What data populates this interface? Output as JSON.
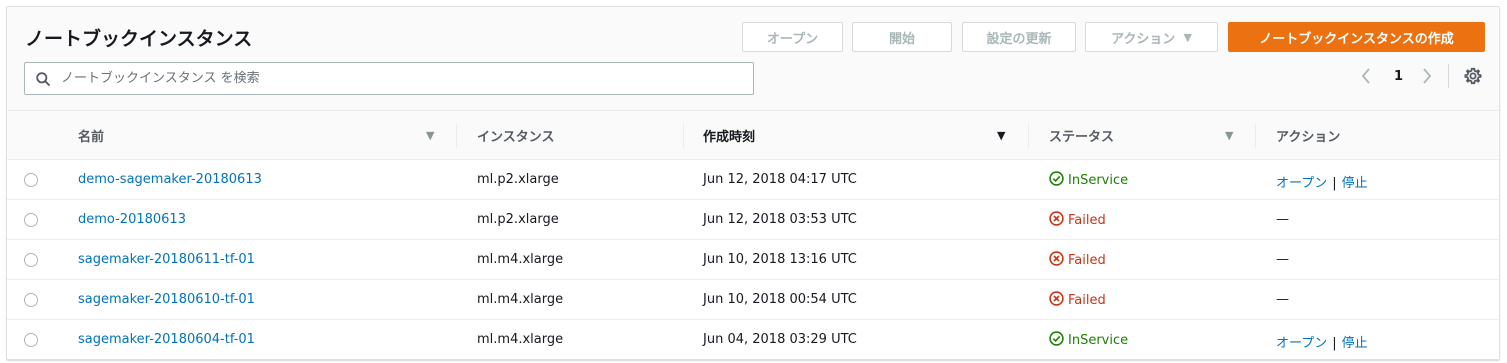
{
  "header": {
    "title": "ノートブックインスタンス",
    "buttons": {
      "open": "オープン",
      "start": "開始",
      "update": "設定の更新",
      "actions": "アクション",
      "create": "ノートブックインスタンスの作成"
    },
    "search_placeholder": "ノートブックインスタンス を検索",
    "page_number": "1"
  },
  "colors": {
    "primary": "#ec7211",
    "link": "#0073bb",
    "success": "#1d8102",
    "error": "#d13212"
  },
  "table": {
    "columns": [
      "名前",
      "インスタンス",
      "作成時刻",
      "ステータス",
      "アクション"
    ],
    "rows": [
      {
        "name": "demo-sagemaker-20180613",
        "instance": "ml.p2.xlarge",
        "created": "Jun 12, 2018 04:17 UTC",
        "status": "InService",
        "status_kind": "ok",
        "action_open": "オープン",
        "action_sep": "|",
        "action_stop": "停止",
        "action_none": ""
      },
      {
        "name": "demo-20180613",
        "instance": "ml.p2.xlarge",
        "created": "Jun 12, 2018 03:53 UTC",
        "status": "Failed",
        "status_kind": "fail",
        "action_open": "",
        "action_sep": "",
        "action_stop": "",
        "action_none": "—"
      },
      {
        "name": "sagemaker-20180611-tf-01",
        "instance": "ml.m4.xlarge",
        "created": "Jun 10, 2018 13:16 UTC",
        "status": "Failed",
        "status_kind": "fail",
        "action_open": "",
        "action_sep": "",
        "action_stop": "",
        "action_none": "—"
      },
      {
        "name": "sagemaker-20180610-tf-01",
        "instance": "ml.m4.xlarge",
        "created": "Jun 10, 2018 00:54 UTC",
        "status": "Failed",
        "status_kind": "fail",
        "action_open": "",
        "action_sep": "",
        "action_stop": "",
        "action_none": "—"
      },
      {
        "name": "sagemaker-20180604-tf-01",
        "instance": "ml.m4.xlarge",
        "created": "Jun 04, 2018 03:29 UTC",
        "status": "InService",
        "status_kind": "ok",
        "action_open": "オープン",
        "action_sep": "|",
        "action_stop": "停止",
        "action_none": ""
      }
    ]
  }
}
